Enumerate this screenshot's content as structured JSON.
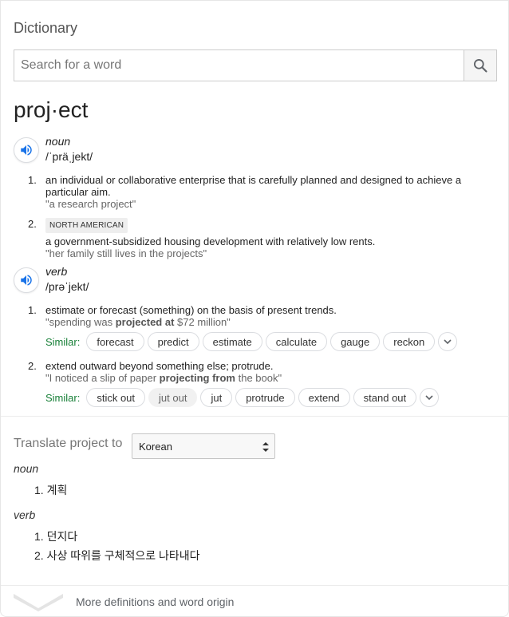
{
  "header": {
    "title": "Dictionary"
  },
  "search": {
    "placeholder": "Search for a word",
    "button_icon": "search-icon"
  },
  "entry": {
    "headword": "proj·ect",
    "noun": {
      "pos": "noun",
      "phonetic": "/ˈpräˌjekt/",
      "definitions": [
        {
          "num": "1.",
          "text": "an individual or collaborative enterprise that is carefully planned and designed to achieve a particular aim.",
          "example": "\"a research project\""
        },
        {
          "num": "2.",
          "badge": "NORTH AMERICAN",
          "text": "a government-subsidized housing development with relatively low rents.",
          "example": "\"her family still lives in the projects\""
        }
      ]
    },
    "verb": {
      "pos": "verb",
      "phonetic": "/prəˈjekt/",
      "definitions": [
        {
          "num": "1.",
          "text": "estimate or forecast (something) on the basis of present trends.",
          "example_pre": "\"spending was ",
          "example_bold": "projected at",
          "example_post": " $72 million\"",
          "similar_label": "Similar:",
          "similar": [
            "forecast",
            "predict",
            "estimate",
            "calculate",
            "gauge",
            "reckon"
          ]
        },
        {
          "num": "2.",
          "text": "extend outward beyond something else; protrude.",
          "example_pre": "\"I noticed a slip of paper ",
          "example_bold": "projecting from",
          "example_post": " the book\"",
          "similar_label": "Similar:",
          "similar": [
            "stick out",
            "jut out",
            "jut",
            "protrude",
            "extend",
            "stand out"
          ]
        }
      ]
    }
  },
  "translate": {
    "label": "Translate project to",
    "language": "Korean",
    "noun_label": "noun",
    "noun_items": [
      "1. 계획"
    ],
    "verb_label": "verb",
    "verb_items": [
      "1. 던지다",
      "2. 사상 따위를 구체적으로 나타내다"
    ]
  },
  "footer": {
    "more_label": "More definitions and word origin"
  },
  "colors": {
    "accent": "#1a73e8",
    "similar_green": "#188038"
  }
}
